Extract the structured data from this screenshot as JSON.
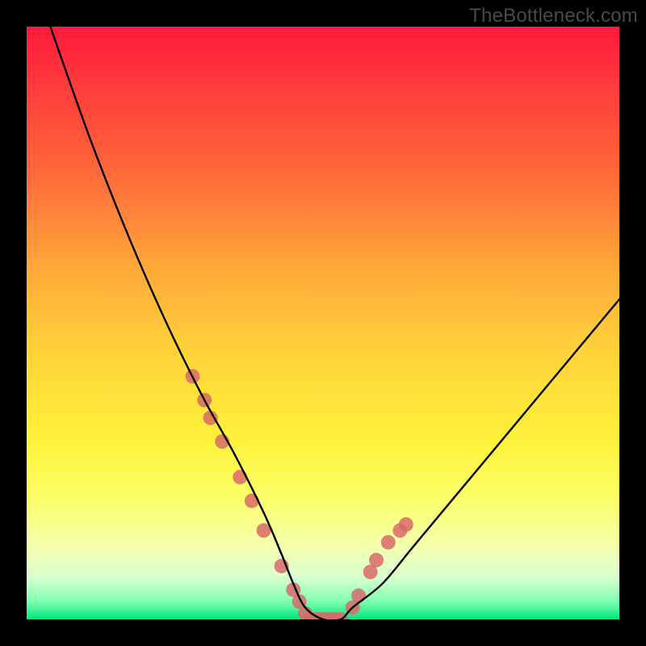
{
  "watermark": "TheBottleneck.com",
  "chart_data": {
    "type": "line",
    "title": "",
    "xlabel": "",
    "ylabel": "",
    "xlim": [
      0,
      100
    ],
    "ylim": [
      0,
      100
    ],
    "background_gradient": {
      "top": "#ff1a3a",
      "middle": "#fff23a",
      "bottom": "#00e57a"
    },
    "series": [
      {
        "name": "bottleneck-curve",
        "color": "#000000",
        "x": [
          4,
          10,
          15,
          20,
          25,
          30,
          35,
          40,
          43,
          45,
          47,
          50,
          53,
          55,
          60,
          65,
          70,
          75,
          80,
          85,
          90,
          95,
          100
        ],
        "values": [
          100,
          83,
          70,
          58,
          47,
          37,
          28,
          18,
          11,
          6,
          2,
          0,
          0,
          2,
          6,
          12,
          18,
          24,
          30,
          36,
          42,
          48,
          54
        ]
      }
    ],
    "markers": {
      "name": "sample-points",
      "color": "#d86a6a",
      "radius_px": 9,
      "x": [
        28,
        30,
        31,
        33,
        36,
        38,
        40,
        43,
        45,
        46,
        47,
        48,
        49,
        50,
        51,
        52,
        53,
        55,
        56,
        58,
        59,
        61,
        63,
        64
      ],
      "values": [
        41,
        37,
        34,
        30,
        24,
        20,
        15,
        9,
        5,
        3,
        1,
        0,
        0,
        0,
        0,
        0,
        0,
        2,
        4,
        8,
        10,
        13,
        15,
        16
      ]
    }
  }
}
